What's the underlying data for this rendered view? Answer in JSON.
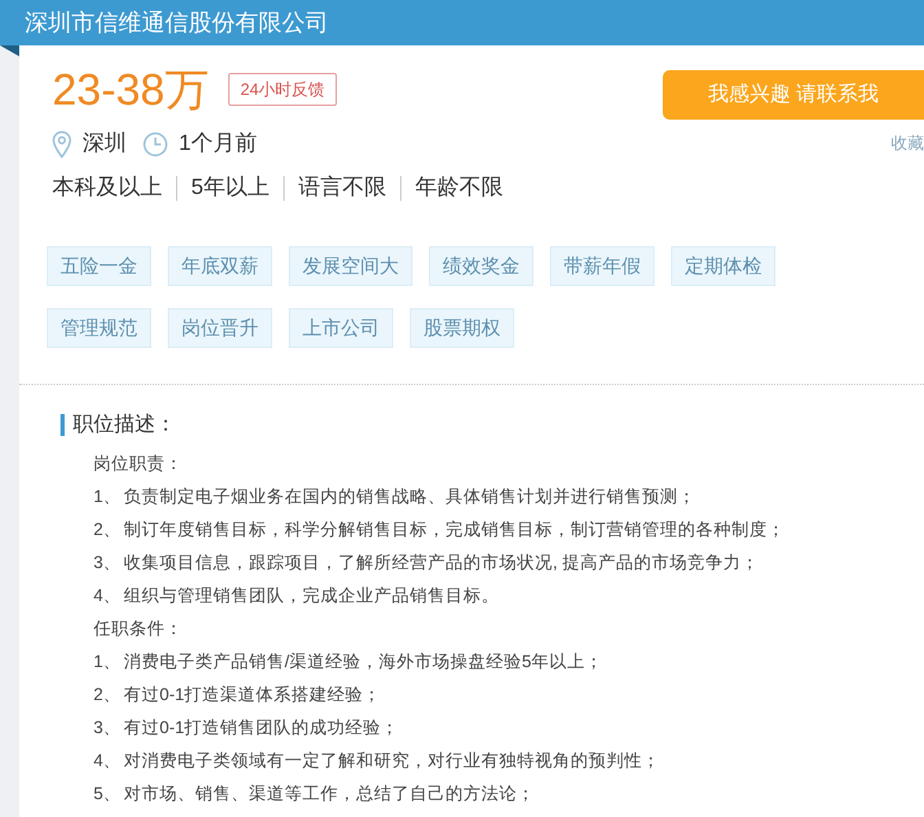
{
  "header": {
    "company": "深圳市信维通信股份有限公司"
  },
  "job": {
    "salary": "23-38万",
    "badge": "24小时反馈",
    "location": "深圳",
    "posted": "1个月前",
    "requirements": [
      "本科及以上",
      "5年以上",
      "语言不限",
      "年龄不限"
    ]
  },
  "apply_button": "我感兴趣 请联系我",
  "favorite": "收藏",
  "tags": [
    "五险一金",
    "年底双薪",
    "发展空间大",
    "绩效奖金",
    "带薪年假",
    "定期体检",
    "管理规范",
    "岗位晋升",
    "上市公司",
    "股票期权"
  ],
  "description": {
    "title": "职位描述：",
    "sections": [
      {
        "heading": "岗位职责：",
        "items": [
          {
            "number": "1、",
            "text": "负责制定电子烟业务在国内的销售战略、具体销售计划并进行销售预测；"
          },
          {
            "number": "2、",
            "text": "制订年度销售目标，科学分解销售目标，完成销售目标，制订营销管理的各种制度；"
          },
          {
            "number": "3、",
            "text": "收集项目信息，跟踪项目，了解所经营产品的市场状况, 提高产品的市场竞争力；"
          },
          {
            "number": "4、",
            "text": "组织与管理销售团队，完成企业产品销售目标。"
          }
        ]
      },
      {
        "heading": "任职条件：",
        "items": [
          {
            "number": "1、",
            "text": "消费电子类产品销售/渠道经验，海外市场操盘经验5年以上；"
          },
          {
            "number": "2、",
            "text": "有过0-1打造渠道体系搭建经验；"
          },
          {
            "number": "3、",
            "text": "有过0-1打造销售团队的成功经验；"
          },
          {
            "number": "4、",
            "text": "对消费电子类领域有一定了解和研究，对行业有独特视角的预判性；"
          },
          {
            "number": "5、",
            "text": "对市场、销售、渠道等工作，总结了自己的方法论；"
          }
        ]
      }
    ]
  }
}
